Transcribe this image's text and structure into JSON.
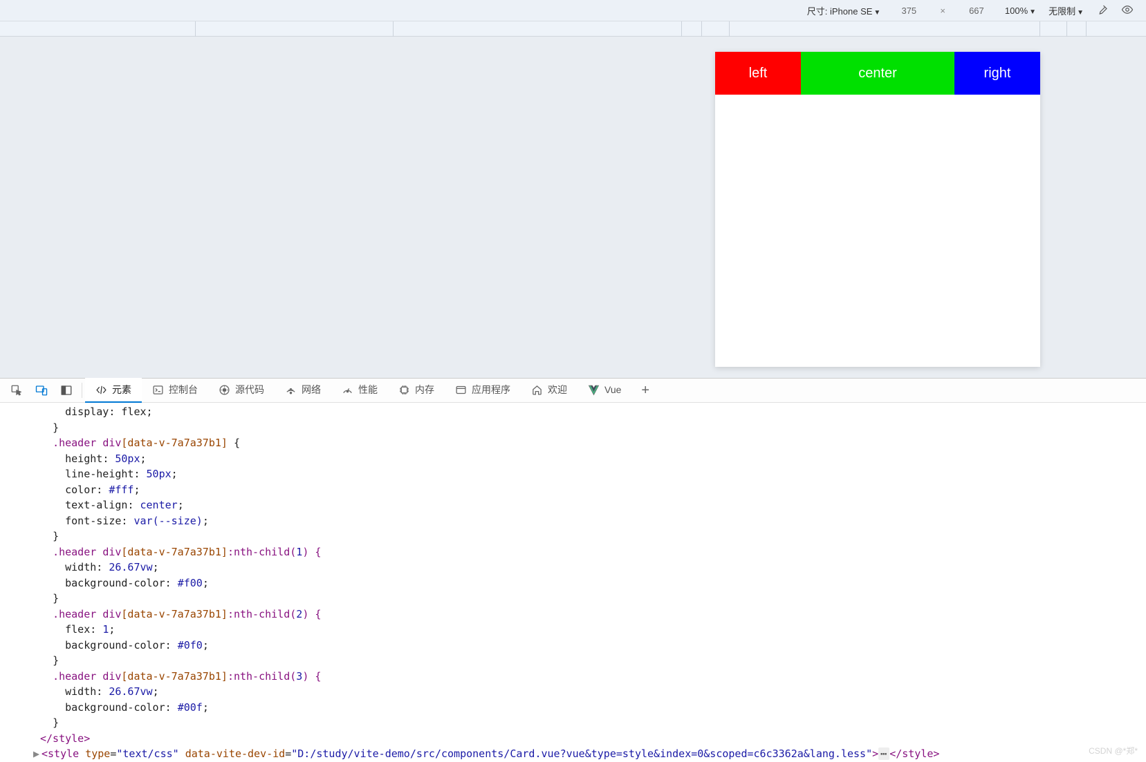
{
  "toolbar": {
    "size_label": "尺寸:",
    "device_name": "iPhone SE",
    "width": "375",
    "height": "667",
    "zoom": "100%",
    "throttle": "无限制"
  },
  "preview": {
    "left_label": "left",
    "center_label": "center",
    "right_label": "right"
  },
  "tabs": {
    "elements": "元素",
    "console": "控制台",
    "sources": "源代码",
    "network": "网络",
    "performance": "性能",
    "memory": "内存",
    "application": "应用程序",
    "welcome": "欢迎",
    "vue": "Vue"
  },
  "code": {
    "l1": "display: flex;",
    "l2": "}",
    "l3_sel": ".header",
    "l3_el": "div",
    "l3_attr": "[data-v-7a7a37b1]",
    "l3_end": " {",
    "l4_p": "height",
    "l4_v": "50px",
    "l5_p": "line-height",
    "l5_v": "50px",
    "l6_p": "color",
    "l6_v": "#fff",
    "l7_p": "text-align",
    "l7_v": "center",
    "l8_p": "font-size",
    "l8_v1": "var",
    "l8_v2": "(--size)",
    "l9": "}",
    "l10_sel": ".header",
    "l10_el": "div",
    "l10_attr": "[data-v-7a7a37b1]",
    "l10_pc": ":nth-child(",
    "l10_n": "1",
    "l10_end": ") {",
    "l11_p": "width",
    "l11_v": "26.67vw",
    "l12_p": "background-color",
    "l12_v": "#f00",
    "l13": "}",
    "l14_sel": ".header",
    "l14_el": "div",
    "l14_attr": "[data-v-7a7a37b1]",
    "l14_pc": ":nth-child(",
    "l14_n": "2",
    "l14_end": ") {",
    "l15_p": "flex",
    "l15_v": "1",
    "l16_p": "background-color",
    "l16_v": "#0f0",
    "l17": "}",
    "l18_sel": ".header",
    "l18_el": "div",
    "l18_attr": "[data-v-7a7a37b1]",
    "l18_pc": ":nth-child(",
    "l18_n": "3",
    "l18_end": ") {",
    "l19_p": "width",
    "l19_v": "26.67vw",
    "l20_p": "background-color",
    "l20_v": "#00f",
    "l21": "}",
    "l22": "</style>",
    "l23_tag": "style",
    "l23_a1n": "type",
    "l23_a1v": "\"text/css\"",
    "l23_a2n": "data-vite-dev-id",
    "l23_a2v": "\"D:/study/vite-demo/src/components/Card.vue?vue&type=style&index=0&scoped=c6c3362a&lang.less\"",
    "l23_close": "</style>"
  },
  "watermark": "CSDN @*郑*"
}
